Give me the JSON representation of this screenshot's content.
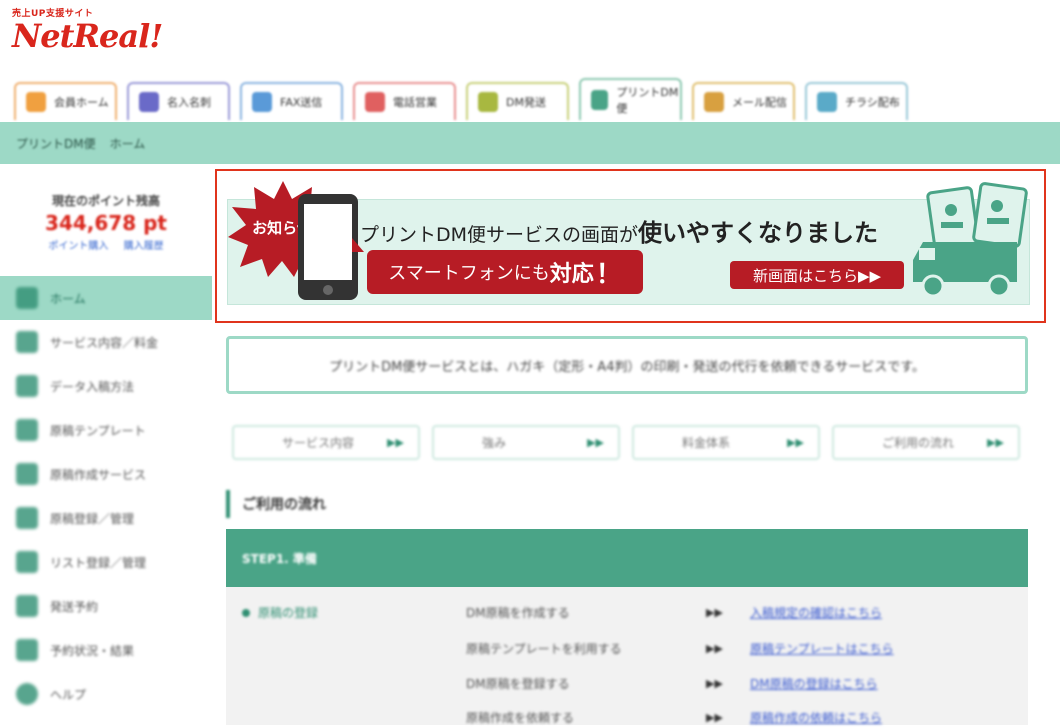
{
  "header": {
    "logo_tagline": "売上UP支援サイト",
    "logo_text": "NetReal!",
    "tabs": [
      {
        "label": "会員ホーム",
        "color": "#f0a040"
      },
      {
        "label": "名入名刺",
        "color": "#6a6ac8"
      },
      {
        "label": "FAX送信",
        "color": "#5a9ad8"
      },
      {
        "label": "電話営業",
        "color": "#e06060"
      },
      {
        "label": "DM発送",
        "color": "#a8b840"
      },
      {
        "label": "プリントDM便",
        "color": "#4aa487"
      },
      {
        "label": "メール配信",
        "color": "#d8a040"
      },
      {
        "label": "チラシ配布",
        "color": "#5aaac8"
      }
    ]
  },
  "breadcrumb": {
    "service": "プリントDM便",
    "page": "ホーム"
  },
  "sidebar": {
    "points_label": "現在のポイント残高",
    "points_value": "344,678 pt",
    "points_link_buy": "ポイント購入",
    "points_link_history": "購入履歴",
    "items": [
      {
        "label": "ホーム"
      },
      {
        "label": "サービス内容／料金"
      },
      {
        "label": "データ入稿方法"
      },
      {
        "label": "原稿テンプレート"
      },
      {
        "label": "原稿作成サービス"
      },
      {
        "label": "原稿登録／管理"
      },
      {
        "label": "リスト登録／管理"
      },
      {
        "label": "発送予約"
      },
      {
        "label": "予約状況・結果"
      },
      {
        "label": "ヘルプ"
      }
    ]
  },
  "banner": {
    "badge": "お知らせ",
    "headline_part": "プリントDM便サービスの画面が",
    "headline_bold": "使いやすくなりました",
    "smartphone_part": "スマートフォンにも",
    "smartphone_bold": "対応",
    "smartphone_excl": "！",
    "new_screen_button": "新画面はこちら▶▶"
  },
  "description": "プリントDM便サービスとは、ハガキ（定形・A4判）の印刷・発送の代行を依頼できるサービスです。",
  "subnav": [
    {
      "label": "サービス内容",
      "arrow": "▶▶"
    },
    {
      "label": "強み",
      "arrow": "▶▶"
    },
    {
      "label": "料金体系",
      "arrow": "▶▶"
    },
    {
      "label": "ご利用の流れ",
      "arrow": "▶▶"
    }
  ],
  "flow": {
    "title": "ご利用の流れ",
    "step_header": "STEP1. 準備",
    "category": "原稿の登録",
    "rows": [
      {
        "text": "DM原稿を作成する",
        "arrow": "▶▶",
        "link": "入稿規定の確認はこちら"
      },
      {
        "text": "原稿テンプレートを利用する",
        "arrow": "▶▶",
        "link": "原稿テンプレートはこちら"
      },
      {
        "text": "DM原稿を登録する",
        "arrow": "▶▶",
        "link": "DM原稿の登録はこちら"
      },
      {
        "text": "原稿作成を依頼する",
        "arrow": "▶▶",
        "link": "原稿作成の依頼はこちら"
      }
    ]
  },
  "colors": {
    "accent": "#9dd9c6",
    "brand_green": "#2f8f72",
    "brand_red": "#b71c25",
    "highlight_border": "#e0341c"
  }
}
